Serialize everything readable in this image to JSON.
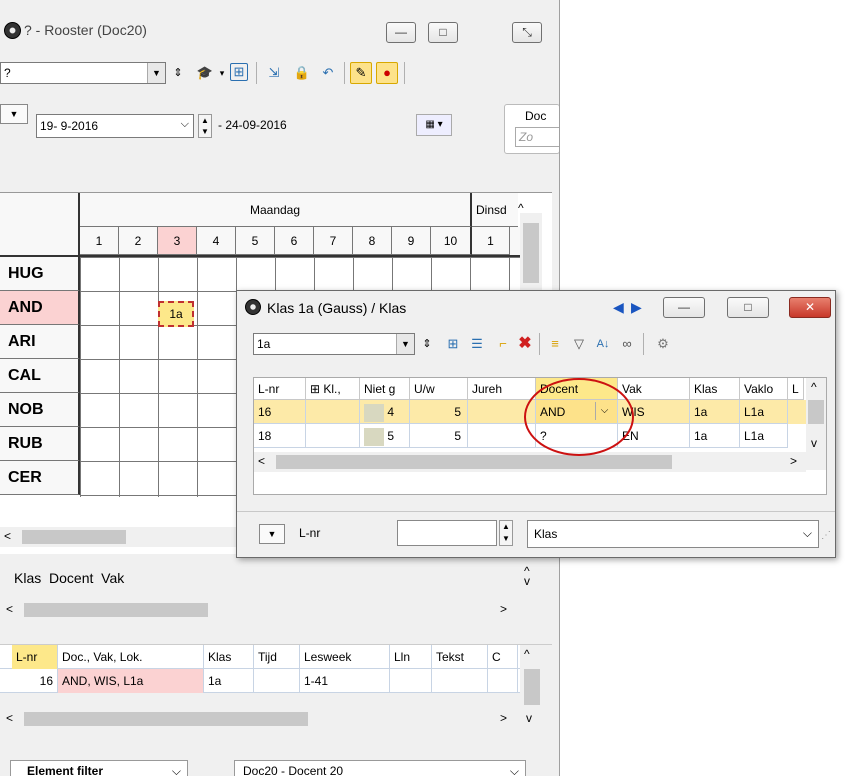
{
  "main_window": {
    "title": "? -  Rooster (Doc20)",
    "minimize": "—",
    "maximize": "□",
    "close": "⤡",
    "element_combo_value": "?",
    "date_from": "19- 9-2016",
    "date_to": "- 24-09-2016",
    "docent_label": "Doc",
    "docent_placeholder": "Zo"
  },
  "timetable": {
    "day1": "Maandag",
    "day2": "Dinsd",
    "hours_day1": [
      "1",
      "2",
      "3",
      "4",
      "5",
      "6",
      "7",
      "8",
      "9",
      "10"
    ],
    "hours_day2": [
      "1"
    ],
    "rows": [
      "HUG",
      "AND",
      "ARI",
      "CAL",
      "NOB",
      "RUB",
      "CER"
    ],
    "highlight_cell_label": "1a"
  },
  "klas_panel": {
    "header": "Klas  Docent  Vak"
  },
  "lessons_table": {
    "columns": [
      "L-nr",
      "Doc., Vak, Lok.",
      "Klas",
      "Tijd",
      "Lesweek",
      "Lln",
      "Tekst",
      "C"
    ],
    "row": [
      "16",
      "AND, WIS, L1a",
      "1a",
      "",
      "1-41",
      "",
      "",
      ""
    ]
  },
  "footer": {
    "filter_label": "Element filter",
    "filter_value": "Doc20 - Docent 20"
  },
  "klas_window": {
    "title": "Klas 1a (Gauss) / Klas",
    "element_value": "1a",
    "columns": [
      "L-nr",
      "⊞ Kl.,",
      "Niet g",
      "U/w",
      "Jureh",
      "Docent",
      "Vak",
      "Klas",
      "Vaklo",
      "L"
    ],
    "rows": [
      {
        "lnr": "16",
        "kl": "",
        "niet": "4",
        "uw": "5",
        "jur": "",
        "docent": "AND",
        "vak": "WIS",
        "klas": "1a",
        "vaklok": "L1a"
      },
      {
        "lnr": "18",
        "kl": "",
        "niet": "5",
        "uw": "5",
        "jur": "",
        "docent": "?",
        "vak": "EN",
        "klas": "1a",
        "vaklok": "L1a"
      }
    ],
    "sort_label": "L-nr",
    "bottom_combo_value": "Klas"
  },
  "colors": {
    "selected_row": "#fdeaa8",
    "pink_row": "#fbd2d2",
    "klas_close": "#d9453b",
    "annotation": "#cc1111"
  }
}
